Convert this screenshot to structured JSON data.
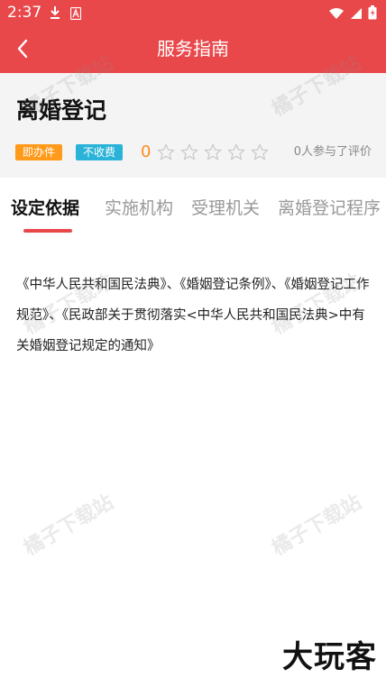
{
  "status_bar": {
    "time": "2:37",
    "left_icons": [
      "download-icon",
      "a-icon"
    ],
    "right_icons": [
      "wifi-icon",
      "signal-icon",
      "battery-icon"
    ]
  },
  "app_bar": {
    "title": "服务指南",
    "back_icon": "back-arrow-icon"
  },
  "item": {
    "title": "离婚登记",
    "badges": [
      "即办件",
      "不收费"
    ],
    "rating_score": "0",
    "stars_total": 5,
    "stars_filled": 0,
    "rating_text": "0人参与了评价"
  },
  "tabs": [
    {
      "label": "设定依据",
      "active": true
    },
    {
      "label": "实施机构",
      "active": false
    },
    {
      "label": "受理机关",
      "active": false
    },
    {
      "label": "离婚登记程序",
      "active": false
    }
  ],
  "content": {
    "text": "《中华人民共和国民法典》、《婚姻登记条例》、《婚姻登记工作规范》、《民政部关于贯彻落实<中华人民共和国民法典>中有关婚姻登记规定的通知》"
  },
  "watermark": {
    "text": "橘子下载站"
  },
  "brand": {
    "logo_text": "大玩客"
  },
  "colors": {
    "primary": "#e9484b",
    "badge_orange": "#ff9a1a",
    "badge_blue": "#2ab3d8",
    "score_orange": "#ff8a1c",
    "header_bg": "#f4f4f4"
  }
}
